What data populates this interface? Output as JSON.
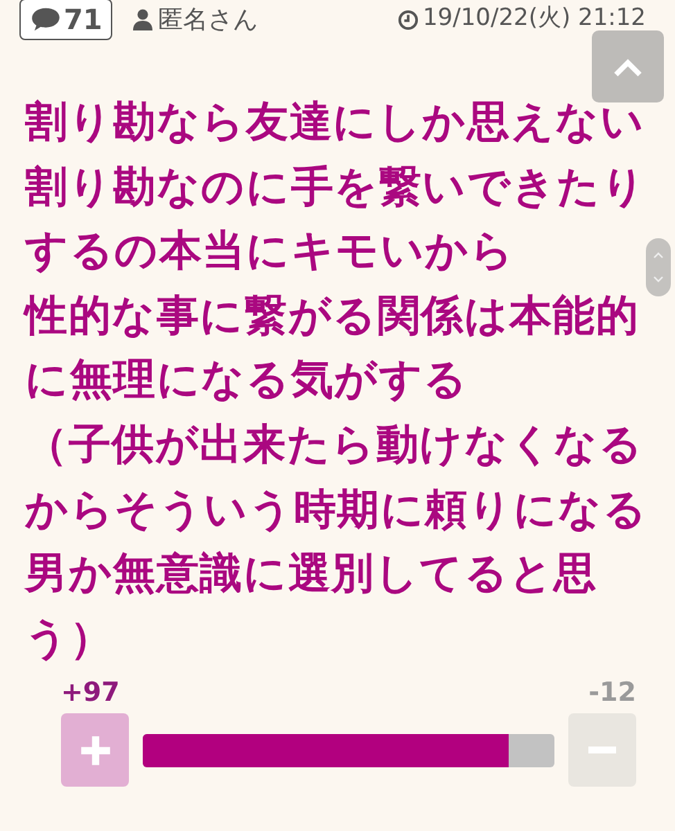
{
  "header": {
    "reply_count": "71",
    "author": "匿名さん",
    "timestamp": "19/10/22(火) 21:12"
  },
  "body_lines": [
    "割り勘なら友達にしか思えない",
    "割り勘なのに手を繋いできたり",
    "するの本当にキモいから",
    "性的な事に繋がる関係は本能的",
    "に無理になる気がする",
    "（子供が出来たら動けなくなる",
    "からそういう時期に頼りになる",
    "男か無意識に選別してると思",
    "う）"
  ],
  "votes": {
    "plus": "+97",
    "minus": "-12",
    "level": 0.89
  }
}
